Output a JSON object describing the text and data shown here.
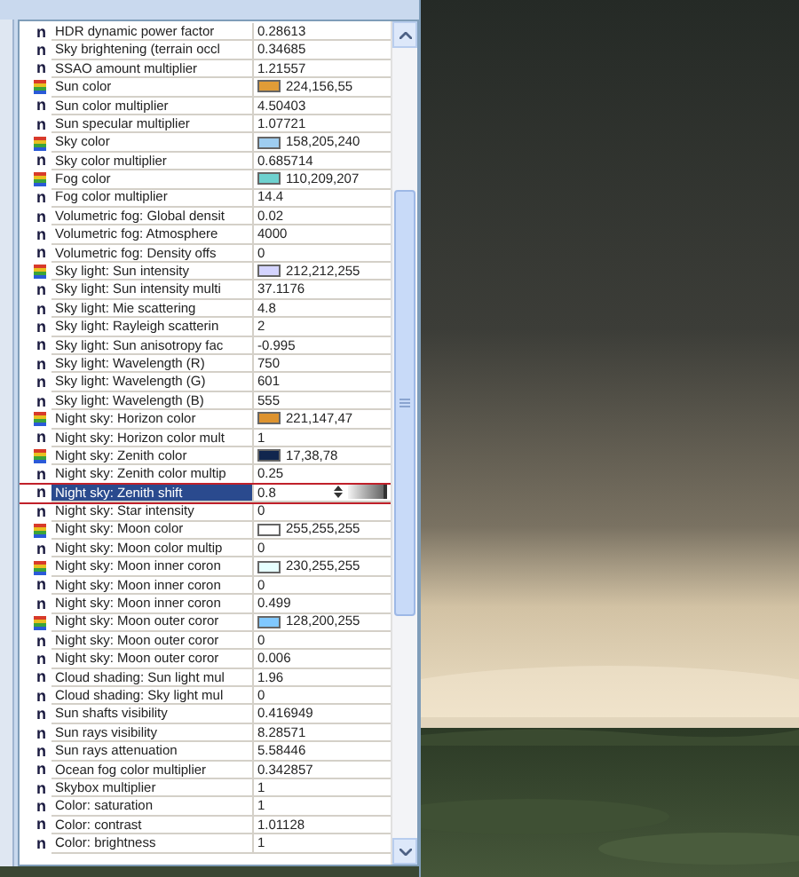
{
  "properties": [
    {
      "kind": "number",
      "glyph": "n",
      "name": "HDR dynamic power factor",
      "value": "0.28613"
    },
    {
      "kind": "number",
      "glyph": "n",
      "name": "Sky brightening (terrain occl",
      "value": "0.34685"
    },
    {
      "kind": "number",
      "glyph": "n",
      "name": "SSAO amount multiplier",
      "value": "1.21557"
    },
    {
      "kind": "color",
      "name": "Sun color",
      "value": "224,156,55",
      "color": "#e09c37"
    },
    {
      "kind": "number",
      "glyph": "n",
      "name": "Sun color multiplier",
      "value": "4.50403"
    },
    {
      "kind": "number",
      "glyph": "n",
      "name": "Sun specular multiplier",
      "value": "1.07721"
    },
    {
      "kind": "color",
      "name": "Sky color",
      "value": "158,205,240",
      "color": "#9ecdf0"
    },
    {
      "kind": "number",
      "glyph": "n",
      "name": "Sky color multiplier",
      "value": "0.685714"
    },
    {
      "kind": "color",
      "name": "Fog color",
      "value": "110,209,207",
      "color": "#6ed1cf"
    },
    {
      "kind": "number",
      "glyph": "n",
      "name": "Fog color multiplier",
      "value": "14.4"
    },
    {
      "kind": "number",
      "glyph": "n",
      "name": "Volumetric fog: Global densit",
      "value": "0.02"
    },
    {
      "kind": "number",
      "glyph": "n",
      "name": "Volumetric fog: Atmosphere",
      "value": "4000"
    },
    {
      "kind": "number",
      "glyph": "n",
      "name": "Volumetric fog: Density offs",
      "value": "0"
    },
    {
      "kind": "color",
      "name": "Sky light: Sun intensity",
      "value": "212,212,255",
      "color": "#d4d4ff"
    },
    {
      "kind": "number",
      "glyph": "n",
      "name": "Sky light: Sun intensity multi",
      "value": "37.1176"
    },
    {
      "kind": "number",
      "glyph": "n",
      "name": "Sky light: Mie scattering",
      "value": "4.8"
    },
    {
      "kind": "number",
      "glyph": "n",
      "name": "Sky light: Rayleigh scatterin",
      "value": "2"
    },
    {
      "kind": "number",
      "glyph": "n",
      "name": "Sky light: Sun anisotropy fac",
      "value": "-0.995"
    },
    {
      "kind": "number",
      "glyph": "n",
      "name": "Sky light: Wavelength (R)",
      "value": "750"
    },
    {
      "kind": "number",
      "glyph": "n",
      "name": "Sky light: Wavelength (G)",
      "value": "601"
    },
    {
      "kind": "number",
      "glyph": "n",
      "name": "Sky light: Wavelength (B)",
      "value": "555"
    },
    {
      "kind": "color",
      "name": "Night sky: Horizon color",
      "value": "221,147,47",
      "color": "#dd932f"
    },
    {
      "kind": "number",
      "glyph": "n",
      "name": "Night sky: Horizon color mult",
      "value": "1"
    },
    {
      "kind": "color",
      "name": "Night sky: Zenith color",
      "value": "17,38,78",
      "color": "#11264e"
    },
    {
      "kind": "number",
      "glyph": "n",
      "name": "Night sky: Zenith color multip",
      "value": "0.25"
    },
    {
      "kind": "number",
      "glyph": "n",
      "name": "Night sky: Zenith shift",
      "value": "0.8",
      "selected": true
    },
    {
      "kind": "number",
      "glyph": "n",
      "name": "Night sky: Star intensity",
      "value": "0"
    },
    {
      "kind": "color",
      "name": "Night sky: Moon color",
      "value": "255,255,255",
      "color": "#ffffff"
    },
    {
      "kind": "number",
      "glyph": "n",
      "name": "Night sky: Moon color multip",
      "value": "0"
    },
    {
      "kind": "color",
      "name": "Night sky: Moon inner coron",
      "value": "230,255,255",
      "color": "#e6ffff"
    },
    {
      "kind": "number",
      "glyph": "n",
      "name": "Night sky: Moon inner coron",
      "value": "0"
    },
    {
      "kind": "number",
      "glyph": "n",
      "name": "Night sky: Moon inner coron",
      "value": "0.499"
    },
    {
      "kind": "color",
      "name": "Night sky: Moon outer coror",
      "value": "128,200,255",
      "color": "#80c8ff"
    },
    {
      "kind": "number",
      "glyph": "n",
      "name": "Night sky: Moon outer coror",
      "value": "0"
    },
    {
      "kind": "number",
      "glyph": "n",
      "name": "Night sky: Moon outer coror",
      "value": "0.006"
    },
    {
      "kind": "number",
      "glyph": "n",
      "name": "Cloud shading: Sun light mul",
      "value": "1.96"
    },
    {
      "kind": "number",
      "glyph": "n",
      "name": "Cloud shading: Sky light mul",
      "value": "0"
    },
    {
      "kind": "number",
      "glyph": "n",
      "name": "Sun shafts visibility",
      "value": "0.416949"
    },
    {
      "kind": "number",
      "glyph": "n",
      "name": "Sun rays visibility",
      "value": "8.28571"
    },
    {
      "kind": "number",
      "glyph": "n",
      "name": "Sun rays attenuation",
      "value": "5.58446"
    },
    {
      "kind": "number",
      "glyph": "n",
      "name": "Ocean fog color multiplier",
      "value": "0.342857"
    },
    {
      "kind": "number",
      "glyph": "n",
      "name": "Skybox multiplier",
      "value": "1"
    },
    {
      "kind": "number",
      "glyph": "n",
      "name": "Color: saturation",
      "value": "1"
    },
    {
      "kind": "number",
      "glyph": "n",
      "name": "Color: contrast",
      "value": "1.01128"
    },
    {
      "kind": "number",
      "glyph": "n",
      "name": "Color: brightness",
      "value": "1"
    }
  ]
}
